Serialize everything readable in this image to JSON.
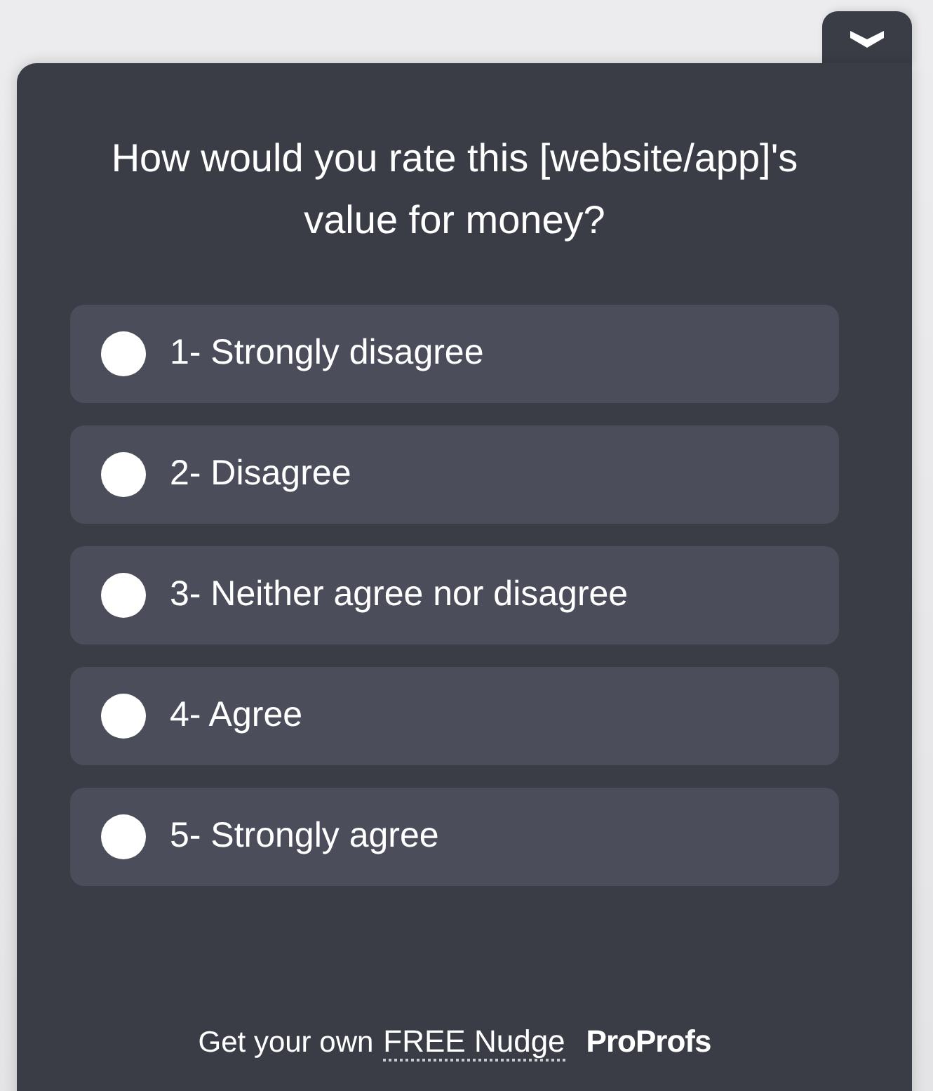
{
  "question": "How would you rate this [website/app]'s value for money?",
  "options": [
    {
      "label": "1- Strongly disagree",
      "selected": false
    },
    {
      "label": "2- Disagree",
      "selected": false
    },
    {
      "label": "3- Neither agree nor disagree",
      "selected": false
    },
    {
      "label": "4- Agree",
      "selected": false
    },
    {
      "label": "5- Strongly agree",
      "selected": false
    }
  ],
  "footer": {
    "text": "Get your own",
    "link": "FREE Nudge",
    "brand": "ProProfs"
  }
}
